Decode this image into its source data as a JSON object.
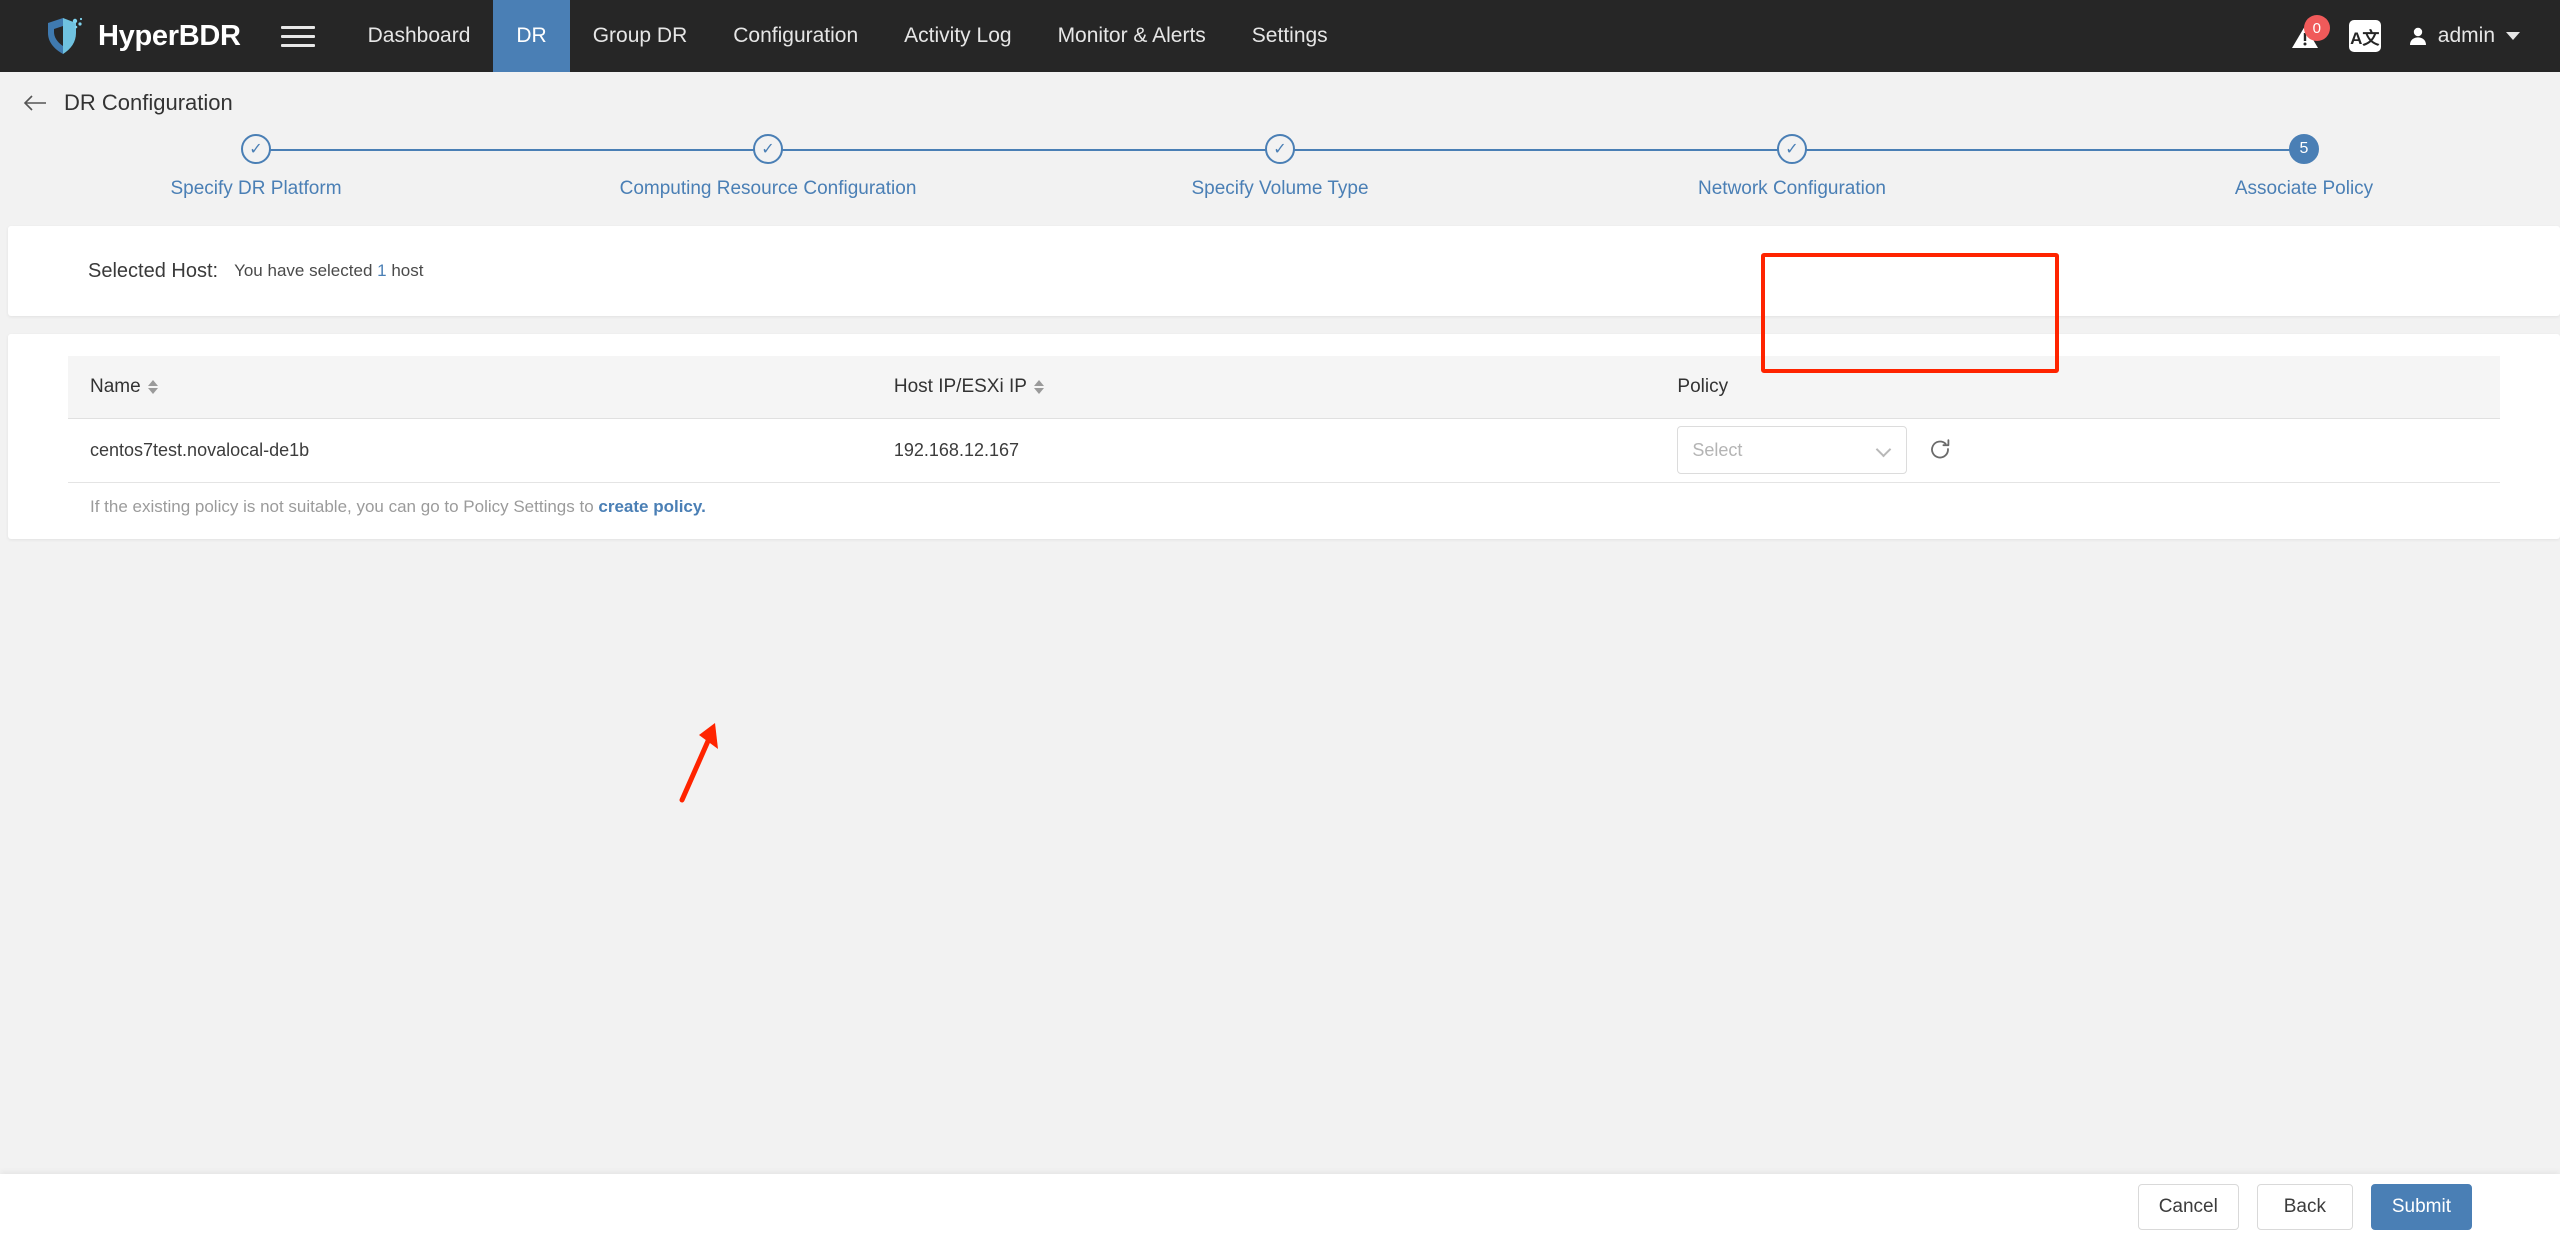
{
  "navbar": {
    "brand": "HyperBDR",
    "menu_icon": "hamburger-icon",
    "items": [
      {
        "label": "Dashboard",
        "active": false
      },
      {
        "label": "DR",
        "active": true
      },
      {
        "label": "Group DR",
        "active": false
      },
      {
        "label": "Configuration",
        "active": false
      },
      {
        "label": "Activity Log",
        "active": false
      },
      {
        "label": "Monitor & Alerts",
        "active": false
      },
      {
        "label": "Settings",
        "active": false
      }
    ],
    "alert_badge": "0",
    "lang_label": "A文",
    "user": "admin"
  },
  "page": {
    "title": "DR Configuration"
  },
  "stepper": {
    "steps": [
      {
        "label": "Specify DR Platform",
        "mark": "✓",
        "state": "done"
      },
      {
        "label": "Computing Resource Configuration",
        "mark": "✓",
        "state": "done"
      },
      {
        "label": "Specify Volume Type",
        "mark": "✓",
        "state": "done"
      },
      {
        "label": "Network Configuration",
        "mark": "✓",
        "state": "done"
      },
      {
        "label": "Associate Policy",
        "mark": "5",
        "state": "active"
      }
    ]
  },
  "selected_host": {
    "label": "Selected Host:",
    "prefix": "You have selected ",
    "count": "1",
    "suffix": " host"
  },
  "table": {
    "columns": [
      {
        "label": "Name",
        "sortable": true
      },
      {
        "label": "Host IP/ESXi IP",
        "sortable": true
      },
      {
        "label": "Policy",
        "sortable": false
      }
    ],
    "rows": [
      {
        "name": "centos7test.novalocal-de1b",
        "host_ip": "192.168.12.167",
        "policy_placeholder": "Select"
      }
    ],
    "hint_text": "If the existing policy is not suitable, you can go to Policy Settings to ",
    "hint_link": "create policy."
  },
  "footer": {
    "cancel": "Cancel",
    "back": "Back",
    "submit": "Submit"
  },
  "colors": {
    "navbar_bg": "#262626",
    "accent": "#4a7fb5",
    "page_bg": "#f2f2f2",
    "annotation": "#ff2400",
    "badge": "#f05a5a"
  }
}
